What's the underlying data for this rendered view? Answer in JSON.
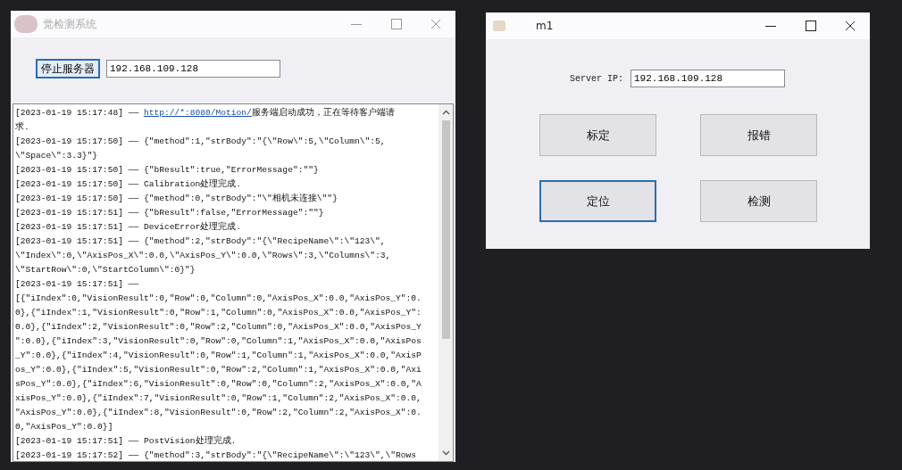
{
  "server_window": {
    "title": "觉检测系统",
    "stop_button": {
      "label": "停止服务器",
      "focused": true
    },
    "address_field": {
      "value": "192.168.109.128"
    },
    "log": [
      {
        "text": "[2023-01-19 15:17:48] —— ",
        "link": "http://*:8080/Motion/",
        "after": "服务端启动成功，正在等待客户端请"
      },
      {
        "text": "求."
      },
      {
        "text": "[2023-01-19 15:17:50] —— {\"method\":1,\"strBody\":\"{\\\"Row\\\":5,\\\"Column\\\":5,"
      },
      {
        "text": "\\\"Space\\\":3.3}\"}"
      },
      {
        "text": "[2023-01-19 15:17:50] —— {\"bResult\":true,\"ErrorMessage\":\"\"}"
      },
      {
        "text": "[2023-01-19 15:17:50] —— Calibration处理完成."
      },
      {
        "text": "[2023-01-19 15:17:50] —— {\"method\":0,\"strBody\":\"\\\"相机未连接\\\"\"}"
      },
      {
        "text": "[2023-01-19 15:17:51] —— {\"bResult\":false,\"ErrorMessage\":\"\"}"
      },
      {
        "text": "[2023-01-19 15:17:51] —— DeviceError处理完成."
      },
      {
        "text": "[2023-01-19 15:17:51] —— {\"method\":2,\"strBody\":\"{\\\"RecipeName\\\":\\\"123\\\","
      },
      {
        "text": "\\\"Index\\\":0,\\\"AxisPos_X\\\":0.0,\\\"AxisPos_Y\\\":0.0,\\\"Rows\\\":3,\\\"Columns\\\":3,"
      },
      {
        "text": "\\\"StartRow\\\":0,\\\"StartColumn\\\":0}\"}"
      },
      {
        "text": "[2023-01-19 15:17:51] ——"
      },
      {
        "text": "[{\"iIndex\":0,\"VisionResult\":0,\"Row\":0,\"Column\":0,\"AxisPos_X\":0.0,\"AxisPos_Y\":0."
      },
      {
        "text": "0},{\"iIndex\":1,\"VisionResult\":0,\"Row\":1,\"Column\":0,\"AxisPos_X\":0.0,\"AxisPos_Y\":"
      },
      {
        "text": "0.0},{\"iIndex\":2,\"VisionResult\":0,\"Row\":2,\"Column\":0,\"AxisPos_X\":0.0,\"AxisPos_Y"
      },
      {
        "text": "\":0.0},{\"iIndex\":3,\"VisionResult\":0,\"Row\":0,\"Column\":1,\"AxisPos_X\":0.0,\"AxisPos"
      },
      {
        "text": "_Y\":0.0},{\"iIndex\":4,\"VisionResult\":0,\"Row\":1,\"Column\":1,\"AxisPos_X\":0.0,\"AxisP"
      },
      {
        "text": "os_Y\":0.0},{\"iIndex\":5,\"VisionResult\":0,\"Row\":2,\"Column\":1,\"AxisPos_X\":0.0,\"Axi"
      },
      {
        "text": "sPos_Y\":0.0},{\"iIndex\":6,\"VisionResult\":0,\"Row\":0,\"Column\":2,\"AxisPos_X\":0.0,\"A"
      },
      {
        "text": "xisPos_Y\":0.0},{\"iIndex\":7,\"VisionResult\":0,\"Row\":1,\"Column\":2,\"AxisPos_X\":0.0,"
      },
      {
        "text": "\"AxisPos_Y\":0.0},{\"iIndex\":8,\"VisionResult\":0,\"Row\":2,\"Column\":2,\"AxisPos_X\":0."
      },
      {
        "text": "0,\"AxisPos_Y\":0.0}]"
      },
      {
        "text": "[2023-01-19 15:17:51] —— PostVision处理完成."
      },
      {
        "text": "[2023-01-19 15:17:52] —— {\"method\":3,\"strBody\":\"{\\\"RecipeName\\\":\\\"123\\\",\\\"Rows"
      }
    ]
  },
  "client_window": {
    "title": "m1",
    "server_ip_label": "Server IP:",
    "server_ip_field": {
      "value": "192.168.109.128"
    },
    "buttons": [
      {
        "label": "标定",
        "focused": false
      },
      {
        "label": "报错",
        "focused": false
      },
      {
        "label": "定位",
        "focused": true
      },
      {
        "label": "检测",
        "focused": false
      }
    ]
  }
}
